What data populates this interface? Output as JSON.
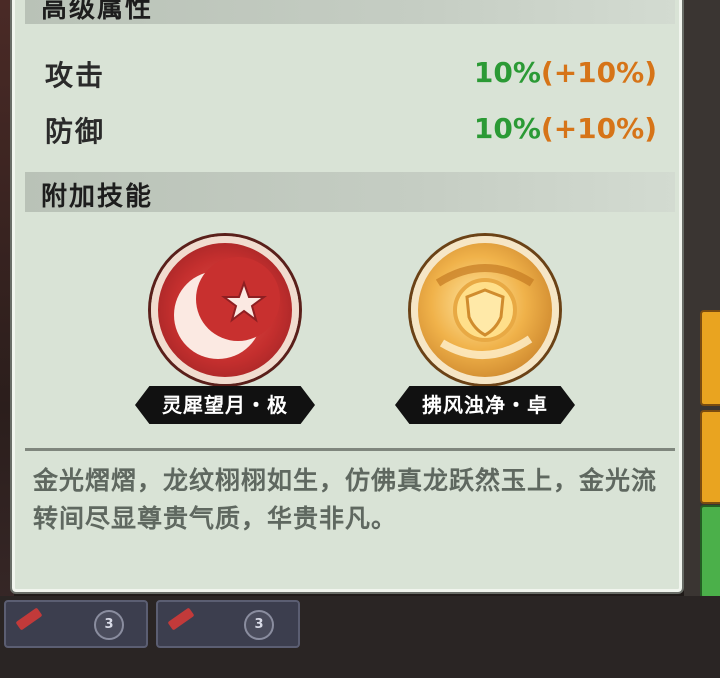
{
  "sections": {
    "advanced_attrs_title": "高级属性",
    "extra_skills_title": "附加技能"
  },
  "attributes": [
    {
      "name": "攻击",
      "base": "10%",
      "bonus": "(+10%)"
    },
    {
      "name": "防御",
      "base": "10%",
      "bonus": "(+10%)"
    }
  ],
  "skills": [
    {
      "name": "灵犀望月・极",
      "icon": "crescent-moon-star-icon"
    },
    {
      "name": "拂风浊净・卓",
      "icon": "shield-swirl-icon"
    }
  ],
  "description": "金光熠熠，龙纹栩栩如生，仿佛真龙跃然玉上，金光流转间尽显尊贵气质，华贵非凡。",
  "bottom_cards": [
    {
      "badge": "3"
    },
    {
      "badge": "3"
    }
  ],
  "colors": {
    "base_value": "#2b9a35",
    "bonus_value": "#d67418",
    "panel_bg": "#d9e3d6"
  }
}
